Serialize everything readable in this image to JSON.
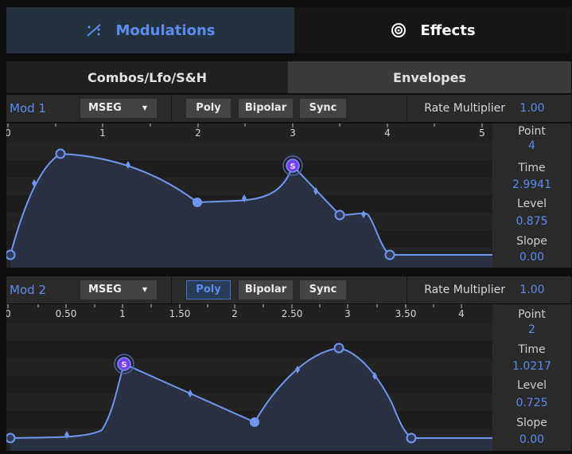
{
  "tabs": {
    "modulations": "Modulations",
    "effects": "Effects"
  },
  "subtabs": {
    "combos": "Combos/Lfo/S&H",
    "envelopes": "Envelopes"
  },
  "mods": [
    {
      "name": "Mod 1",
      "type": "MSEG",
      "buttons": {
        "poly": "Poly",
        "bipolar": "Bipolar",
        "sync": "Sync"
      },
      "poly_active": false,
      "rate_label": "Rate Multiplier",
      "rate_value": "1.00",
      "ruler": [
        "0",
        "1",
        "2",
        "3",
        "4",
        "5"
      ],
      "panel": {
        "point_label": "Point",
        "point": "4",
        "time_label": "Time",
        "time": "2.9941",
        "level_label": "Level",
        "level": "0.875",
        "slope_label": "Slope",
        "slope": "0.00"
      },
      "sustain_label": "S"
    },
    {
      "name": "Mod 2",
      "type": "MSEG",
      "buttons": {
        "poly": "Poly",
        "bipolar": "Bipolar",
        "sync": "Sync"
      },
      "poly_active": true,
      "rate_label": "Rate Multiplier",
      "rate_value": "1.00",
      "ruler": [
        "0",
        "0.50",
        "1",
        "1.50",
        "2",
        "2.50",
        "3",
        "3.50",
        "4"
      ],
      "panel": {
        "point_label": "Point",
        "point": "2",
        "time_label": "Time",
        "time": "1.0217",
        "level_label": "Level",
        "level": "0.725",
        "slope_label": "Slope",
        "slope": "0.00"
      },
      "sustain_label": "S"
    }
  ],
  "colors": {
    "accent": "#5c8df0",
    "sustain": "#7a3cf0",
    "curve": "#6f97ef"
  }
}
